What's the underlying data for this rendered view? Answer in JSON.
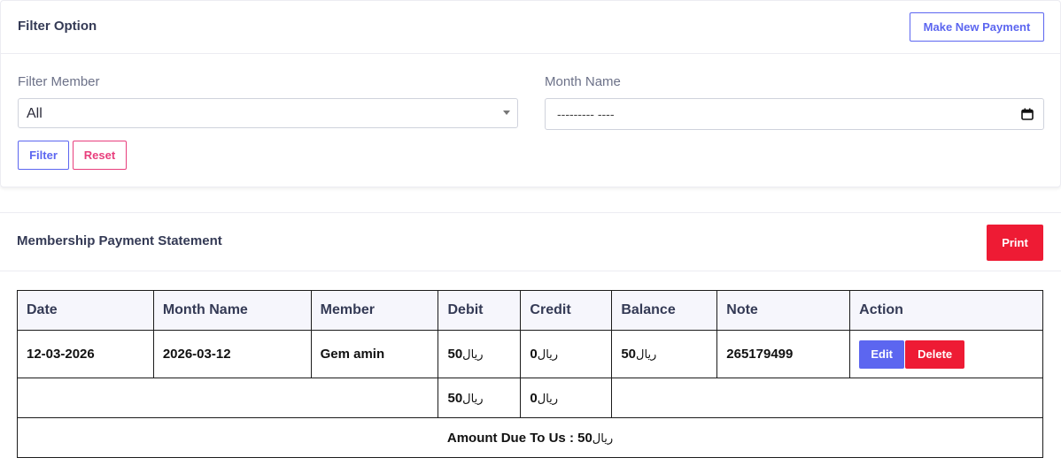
{
  "filter_card": {
    "title": "Filter Option",
    "make_payment_label": "Make New Payment",
    "member_label": "Filter Member",
    "member_selected": "All",
    "month_label": "Month Name",
    "month_placeholder": "--------- ----",
    "filter_label": "Filter",
    "reset_label": "Reset"
  },
  "statement_card": {
    "title": "Membership Payment Statement",
    "print_label": "Print"
  },
  "table": {
    "headers": [
      "Date",
      "Month Name",
      "Member",
      "Debit",
      "Credit",
      "Balance",
      "Note",
      "Action"
    ],
    "rows": [
      {
        "date": "12-03-2026",
        "month_name": "2026-03-12",
        "member": "Gem amin",
        "debit": "50",
        "credit": "0",
        "balance": "50",
        "note": "265179499",
        "edit_label": "Edit",
        "delete_label": "Delete"
      }
    ],
    "currency_symbol": "ریال",
    "total_debit": "50",
    "total_credit": "0",
    "amount_due_label": "Amount Due To Us : 50",
    "amount_due_currency": "ریال"
  },
  "colors": {
    "primary": "#5c66f0",
    "danger": "#ee1b34",
    "reset_pink": "#e83e7c"
  }
}
